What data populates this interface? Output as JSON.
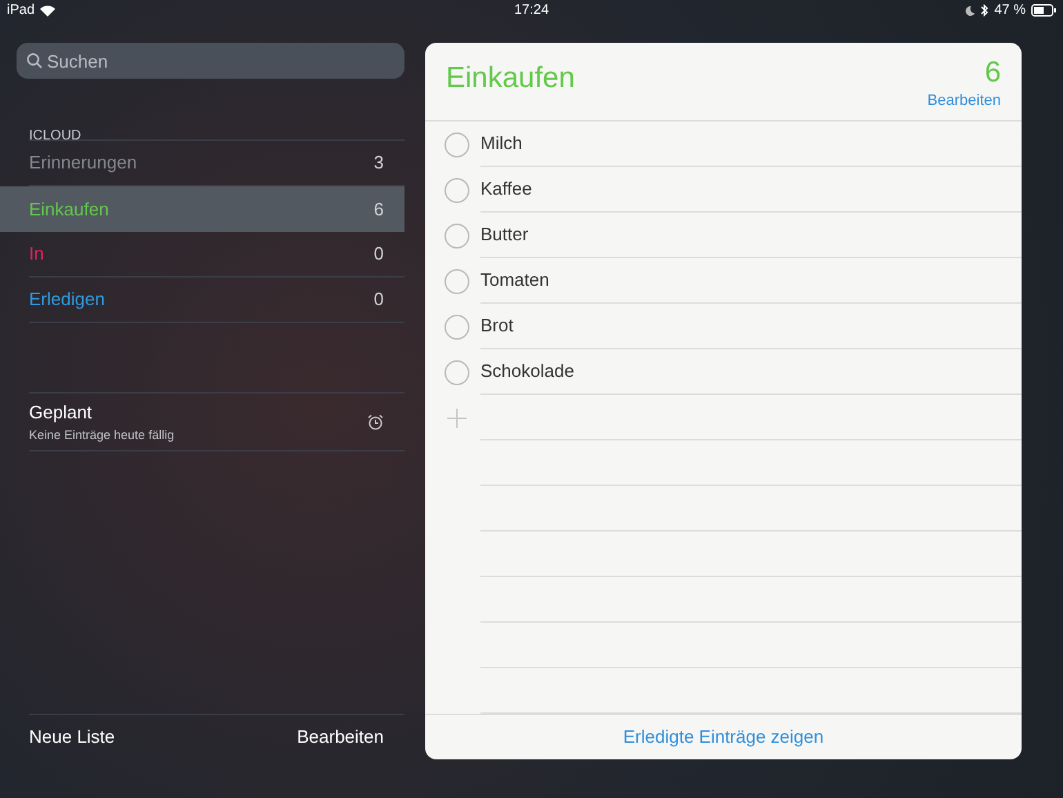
{
  "status_bar": {
    "device": "iPad",
    "time": "17:24",
    "battery": "47 %"
  },
  "search": {
    "placeholder": "Suchen"
  },
  "section": "ICLOUD",
  "lists": [
    {
      "name": "Erinnerungen",
      "count": "3",
      "color": "#85888e",
      "selected": false
    },
    {
      "name": "Einkaufen",
      "count": "6",
      "color": "#62c94a",
      "selected": true
    },
    {
      "name": "In",
      "count": "0",
      "color": "#e0245e",
      "selected": false
    },
    {
      "name": "Erledigen",
      "count": "0",
      "color": "#2f9be0",
      "selected": false
    }
  ],
  "scheduled": {
    "title": "Geplant",
    "subtitle": "Keine Einträge heute fällig"
  },
  "sidebar_footer": {
    "new_list": "Neue Liste",
    "edit": "Bearbeiten"
  },
  "detail": {
    "title": "Einkaufen",
    "count": "6",
    "edit": "Bearbeiten",
    "items": [
      {
        "text": "Milch",
        "checked": false
      },
      {
        "text": "Kaffee",
        "checked": false
      },
      {
        "text": "Butter",
        "checked": false
      },
      {
        "text": "Tomaten",
        "checked": false
      },
      {
        "text": "Brot",
        "checked": false
      },
      {
        "text": "Schokolade",
        "checked": false
      }
    ],
    "footer": "Erledigte Einträge zeigen"
  }
}
